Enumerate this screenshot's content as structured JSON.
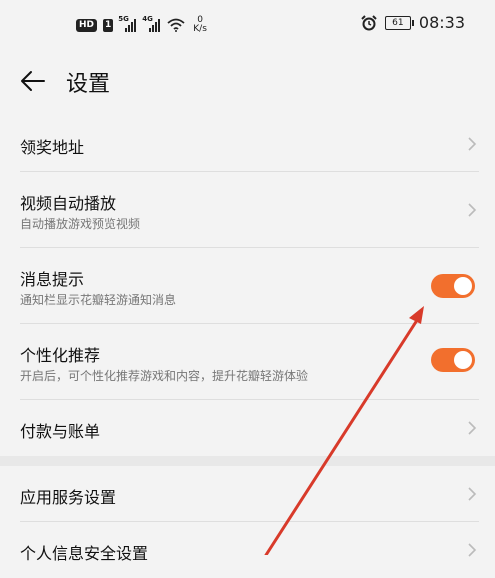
{
  "status_bar": {
    "hd": "HD",
    "sim": "1",
    "signal1": "5G",
    "signal2": "4G",
    "speed_value": "0",
    "speed_unit": "K/s",
    "battery": "61",
    "time": "08:33"
  },
  "header": {
    "title": "设置"
  },
  "rows": [
    {
      "title": "领奖地址"
    },
    {
      "title": "视频自动播放",
      "subtitle": "自动播放游戏预览视频"
    },
    {
      "title": "消息提示",
      "subtitle": "通知栏显示花瓣轻游通知消息",
      "toggle_on": true
    },
    {
      "title": "个性化推荐",
      "subtitle": "开启后，可个性化推荐游戏和内容，提升花瓣轻游体验",
      "toggle_on": true
    },
    {
      "title": "付款与账单"
    },
    {
      "title": "应用服务设置"
    },
    {
      "title": "个人信息安全设置"
    }
  ],
  "colors": {
    "toggle_on": "#f26f2d",
    "annotation_arrow": "#d83a2a"
  }
}
